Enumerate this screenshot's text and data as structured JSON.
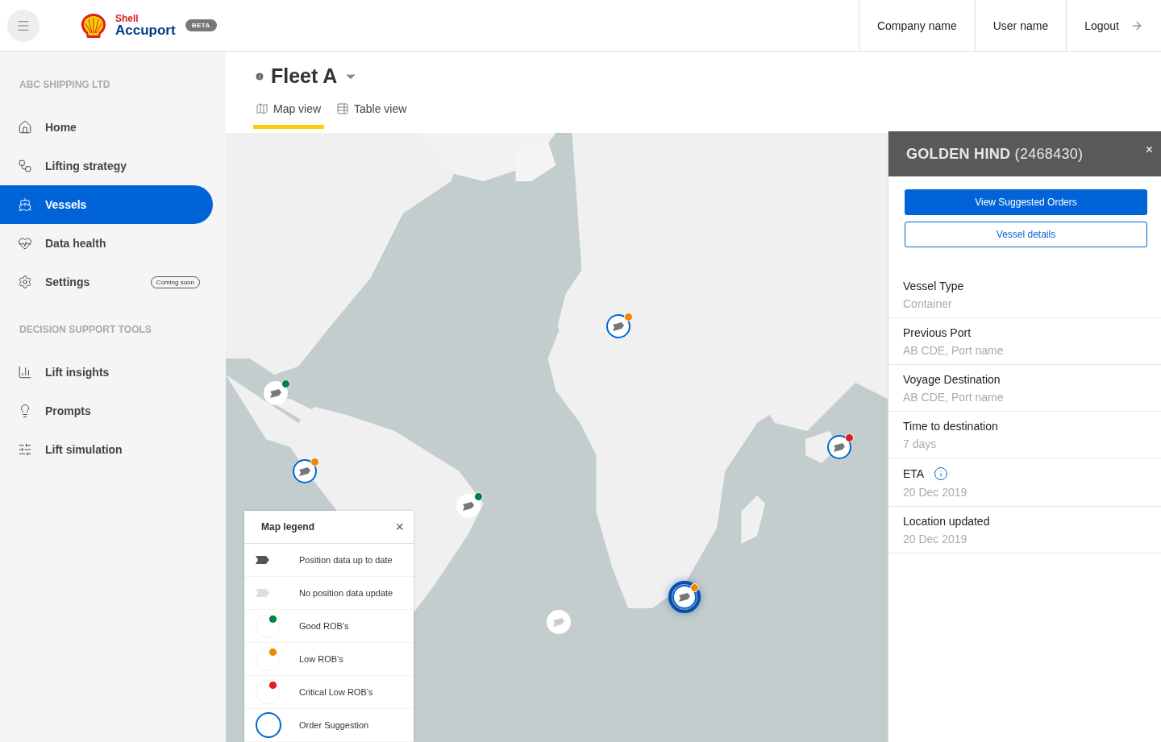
{
  "header": {
    "brand": "Shell",
    "product": "Accuport",
    "badge": "BETA",
    "links": [
      {
        "label": "Company name",
        "kind": "text"
      },
      {
        "label": "User name",
        "kind": "text"
      },
      {
        "label": "Logout",
        "kind": "logout"
      }
    ]
  },
  "sidebar": {
    "sections": [
      {
        "title": "ABC SHIPPING LTD",
        "items": [
          {
            "label": "Home",
            "selected": false
          },
          {
            "label": "Lifting strategy",
            "selected": false
          },
          {
            "label": "Vessels",
            "selected": true
          },
          {
            "label": "Data health",
            "selected": false
          },
          {
            "label": "Settings",
            "selected": false,
            "badge": "Coming soon"
          }
        ]
      },
      {
        "title": "DECISION SUPPORT TOOLS",
        "items": [
          {
            "label": "Lift insights",
            "selected": false
          },
          {
            "label": "Prompts",
            "selected": false
          },
          {
            "label": "Lift simulation",
            "selected": false
          }
        ]
      }
    ]
  },
  "fleet": {
    "title": "Fleet A",
    "tabs": [
      {
        "label": "Map view",
        "selected": true
      },
      {
        "label": "Table view",
        "selected": false
      }
    ]
  },
  "map": {
    "kind": "picture",
    "markers": [
      {
        "up_to_date": true,
        "color": "#ef8a00",
        "order_suggestion": true,
        "selected": false
      },
      {
        "up_to_date": true,
        "color": "#00843d",
        "order_suggestion": false,
        "selected": false
      },
      {
        "up_to_date": true,
        "color": "#ef8a00",
        "order_suggestion": true,
        "selected": false
      },
      {
        "up_to_date": true,
        "color": "#00843d",
        "order_suggestion": false,
        "selected": false
      },
      {
        "up_to_date": true,
        "color": "#dd1d21",
        "order_suggestion": true,
        "selected": false
      },
      {
        "up_to_date": true,
        "color": "#ef8a00",
        "order_suggestion": true,
        "selected": true
      },
      {
        "up_to_date": false,
        "order_suggestion": false,
        "selected": false
      }
    ],
    "legend": {
      "title": "Map legend",
      "close": "×",
      "items": [
        {
          "kind": "up_to_date",
          "label": "Position data up to date"
        },
        {
          "kind": "no_update",
          "label": "No position data update"
        },
        {
          "kind": "rob",
          "color": "#00843d",
          "label": "Good ROB’s"
        },
        {
          "kind": "rob",
          "color": "#ef8a00",
          "label": "Low ROB’s"
        },
        {
          "kind": "rob",
          "color": "#dd1d21",
          "label": "Critical Low ROB’s"
        },
        {
          "kind": "order",
          "label": "Order Suggestion"
        }
      ]
    }
  },
  "panel": {
    "title": "**GOLDEN HIND** (2468430)",
    "close": "×",
    "buttons": [
      {
        "label": "View Suggested Orders",
        "kind": "primary"
      },
      {
        "label": "Vessel details",
        "kind": "secondary"
      }
    ],
    "fields": [
      {
        "label": "Vessel Type",
        "value": "Container",
        "info": false
      },
      {
        "label": "Previous Port",
        "value": "AB CDE, Port name",
        "info": false
      },
      {
        "label": "Voyage Destination",
        "value": "AB CDE, Port name",
        "info": false
      },
      {
        "label": "Time to destination",
        "value": "7 days",
        "info": false
      },
      {
        "label": "ETA",
        "value": "20 Dec 2019",
        "info": true
      },
      {
        "label": "Location updated",
        "value": "20 Dec 2019",
        "info": false
      }
    ]
  }
}
